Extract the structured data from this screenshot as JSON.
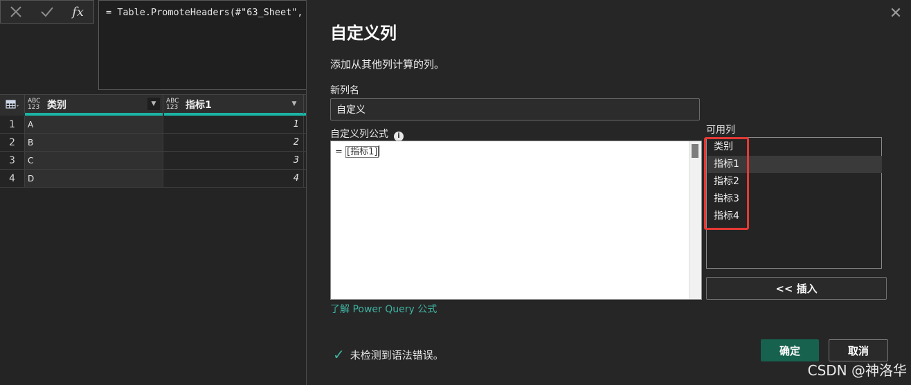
{
  "formula_bar": {
    "text": "= Table.PromoteHeaders(#\"63_Sheet\","
  },
  "formula_icons": {
    "cancel_icon": "close-icon",
    "confirm_icon": "check-icon",
    "fx": "fx"
  },
  "grid": {
    "columns": [
      {
        "type": "ABC 123",
        "name": "类别"
      },
      {
        "type": "ABC 123",
        "name": "指标1"
      }
    ],
    "rows": [
      {
        "num": "1",
        "c1": "A",
        "c2": "1"
      },
      {
        "num": "2",
        "c1": "B",
        "c2": "2"
      },
      {
        "num": "3",
        "c1": "C",
        "c2": "3"
      },
      {
        "num": "4",
        "c1": "D",
        "c2": "4"
      }
    ]
  },
  "dialog": {
    "title": "自定义列",
    "description": "添加从其他列计算的列。",
    "new_column_label": "新列名",
    "new_column_value": "自定义",
    "formula_label": "自定义列公式",
    "formula_prefix": "= ",
    "formula_token": "[指标1]",
    "learn_link": "了解 Power Query 公式",
    "available_label": "可用列",
    "available_columns": [
      "类别",
      "指标1",
      "指标2",
      "指标3",
      "指标4"
    ],
    "selected_column": "指标1",
    "insert_label": "<< 插入",
    "status_text": "未检测到语法错误。",
    "ok_label": "确定",
    "cancel_label": "取消"
  },
  "watermark": "CSDN @神洛华",
  "colors": {
    "accent": "#17614f",
    "link": "#3fb2a0",
    "highlight_box": "#e53935",
    "quality_bar": "#1bb3a3"
  }
}
